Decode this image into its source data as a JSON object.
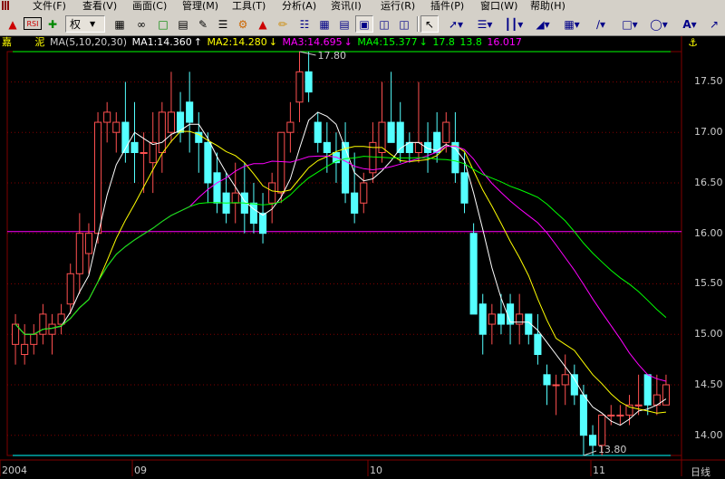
{
  "menubar": {
    "items": [
      "文件(F)",
      "查看(V)",
      "画面(C)",
      "管理(M)",
      "工具(T)",
      "分析(A)",
      "资讯(I)",
      "运行(R)",
      "插件(P)",
      "窗口(W)",
      "帮助(H)"
    ]
  },
  "toolbar": {
    "quan_label": "权"
  },
  "stock": {
    "name_char1": "嘉",
    "name_char2": "泥"
  },
  "ma": {
    "header": "MA(5,10,20,30)",
    "ma1": "MA1:14.360",
    "ma2": "MA2:14.280",
    "ma3": "MA3:14.695",
    "ma4": "MA4:15.377",
    "extra1": "17.8",
    "extra2": "13.8",
    "extra3": "16.017",
    "colors": {
      "ma1": "#ffffff",
      "ma2": "#ffff00",
      "ma3": "#ff00ff",
      "ma4": "#00ff00"
    }
  },
  "chart": {
    "period_label": "日线",
    "high_marker": "17.80",
    "low_marker": "13.80",
    "yaxis": [
      "17.50",
      "17.00",
      "16.50",
      "16.00",
      "15.50",
      "15.00",
      "14.50",
      "14.00"
    ],
    "xaxis": [
      "2004",
      "09",
      "10",
      "11"
    ]
  },
  "chart_data": {
    "type": "candlestick",
    "ylim": [
      13.8,
      17.8
    ],
    "reference_line": 16.017,
    "candles": [
      [
        14.9,
        15.2,
        14.7,
        15.1
      ],
      [
        14.8,
        15.1,
        14.7,
        14.9
      ],
      [
        14.9,
        15.1,
        14.8,
        15.0
      ],
      [
        15.0,
        15.3,
        14.9,
        15.2
      ],
      [
        15.0,
        15.2,
        14.8,
        15.1
      ],
      [
        15.1,
        15.3,
        15.0,
        15.2
      ],
      [
        15.3,
        15.7,
        15.2,
        15.6
      ],
      [
        15.6,
        16.2,
        15.4,
        16.0
      ],
      [
        15.8,
        16.1,
        15.6,
        16.0
      ],
      [
        16.0,
        17.2,
        15.9,
        17.1
      ],
      [
        17.1,
        17.3,
        16.9,
        17.2
      ],
      [
        17.0,
        17.2,
        16.8,
        17.1
      ],
      [
        17.1,
        17.5,
        16.7,
        16.8
      ],
      [
        16.9,
        17.3,
        16.5,
        16.8
      ],
      [
        16.8,
        17.0,
        16.4,
        16.8
      ],
      [
        16.7,
        17.2,
        16.4,
        16.9
      ],
      [
        16.8,
        17.3,
        16.6,
        17.2
      ],
      [
        17.0,
        17.6,
        16.9,
        17.2
      ],
      [
        17.2,
        17.4,
        16.9,
        17.0
      ],
      [
        17.3,
        17.6,
        16.8,
        17.1
      ],
      [
        17.0,
        17.2,
        16.6,
        16.9
      ],
      [
        16.9,
        17.0,
        16.3,
        16.5
      ],
      [
        16.6,
        16.8,
        16.2,
        16.3
      ],
      [
        16.4,
        16.6,
        16.1,
        16.2
      ],
      [
        16.3,
        16.7,
        16.1,
        16.4
      ],
      [
        16.4,
        16.7,
        16.0,
        16.2
      ],
      [
        16.3,
        16.5,
        16.0,
        16.1
      ],
      [
        16.2,
        16.4,
        15.9,
        16.0
      ],
      [
        16.3,
        16.6,
        16.1,
        16.5
      ],
      [
        16.4,
        17.0,
        16.3,
        17.0
      ],
      [
        17.0,
        17.3,
        16.8,
        17.1
      ],
      [
        17.3,
        17.8,
        17.1,
        17.6
      ],
      [
        17.6,
        17.8,
        17.3,
        17.4
      ],
      [
        17.1,
        17.2,
        16.8,
        16.9
      ],
      [
        16.9,
        17.1,
        16.6,
        16.8
      ],
      [
        16.8,
        17.0,
        16.5,
        16.7
      ],
      [
        16.9,
        17.1,
        16.3,
        16.4
      ],
      [
        16.4,
        16.8,
        16.1,
        16.2
      ],
      [
        16.3,
        16.6,
        16.2,
        16.5
      ],
      [
        16.6,
        17.1,
        16.5,
        16.9
      ],
      [
        16.8,
        17.5,
        16.7,
        17.1
      ],
      [
        17.1,
        17.6,
        16.9,
        16.9
      ],
      [
        17.1,
        17.3,
        16.7,
        16.8
      ],
      [
        16.9,
        17.0,
        16.7,
        16.8
      ],
      [
        16.8,
        17.5,
        16.7,
        16.9
      ],
      [
        16.9,
        17.1,
        16.6,
        16.8
      ],
      [
        17.0,
        17.2,
        16.7,
        16.8
      ],
      [
        16.9,
        17.2,
        16.8,
        17.1
      ],
      [
        16.9,
        17.2,
        16.5,
        16.6
      ],
      [
        16.6,
        16.8,
        16.2,
        16.3
      ],
      [
        16.0,
        16.1,
        15.2,
        15.2
      ],
      [
        15.3,
        15.4,
        14.8,
        15.0
      ],
      [
        15.1,
        15.3,
        14.9,
        15.2
      ],
      [
        15.2,
        15.4,
        15.0,
        15.1
      ],
      [
        15.3,
        15.4,
        14.9,
        15.1
      ],
      [
        15.1,
        15.4,
        14.9,
        15.2
      ],
      [
        15.2,
        15.2,
        14.9,
        15.0
      ],
      [
        15.0,
        15.2,
        14.7,
        14.8
      ],
      [
        14.6,
        14.7,
        14.3,
        14.5
      ],
      [
        14.5,
        14.6,
        14.2,
        14.5
      ],
      [
        14.5,
        14.8,
        14.3,
        14.6
      ],
      [
        14.6,
        14.7,
        14.3,
        14.4
      ],
      [
        14.4,
        14.5,
        13.8,
        14.0
      ],
      [
        14.0,
        14.1,
        13.8,
        13.9
      ],
      [
        13.9,
        14.2,
        13.8,
        14.2
      ],
      [
        14.2,
        14.3,
        14.1,
        14.2
      ],
      [
        14.2,
        14.3,
        14.1,
        14.2
      ],
      [
        14.2,
        14.4,
        14.1,
        14.3
      ],
      [
        14.3,
        14.6,
        14.2,
        14.3
      ],
      [
        14.6,
        14.6,
        14.2,
        14.3
      ],
      [
        14.3,
        14.6,
        14.2,
        14.4
      ],
      [
        14.3,
        14.6,
        14.3,
        14.5
      ]
    ]
  }
}
